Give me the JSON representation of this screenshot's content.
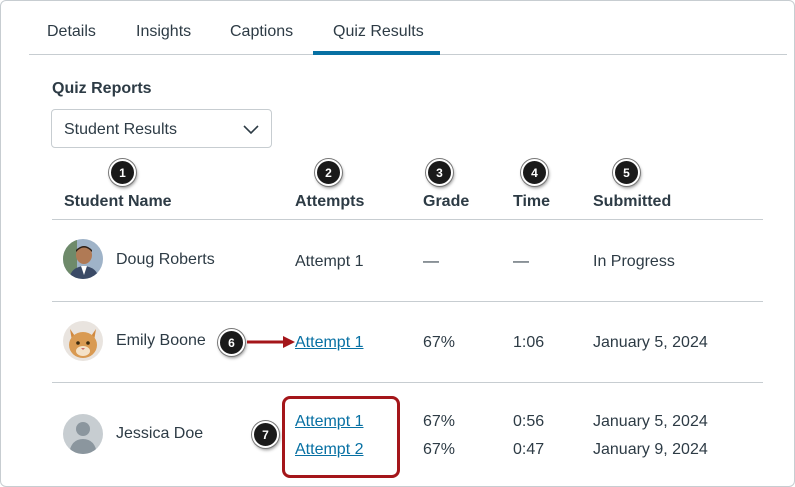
{
  "tabs": [
    {
      "label": "Details"
    },
    {
      "label": "Insights"
    },
    {
      "label": "Captions"
    },
    {
      "label": "Quiz Results"
    }
  ],
  "quiz_reports": {
    "title": "Quiz Reports",
    "selected": "Student Results"
  },
  "columns": [
    "Student Name",
    "Attempts",
    "Grade",
    "Time",
    "Submitted"
  ],
  "callouts": [
    "1",
    "2",
    "3",
    "4",
    "5",
    "6",
    "7"
  ],
  "rows": [
    {
      "name": "Doug Roberts",
      "attempts": [
        {
          "label": "Attempt 1",
          "grade": "—",
          "time": "—",
          "submitted": "In Progress"
        }
      ]
    },
    {
      "name": "Emily Boone",
      "attempts": [
        {
          "label": "Attempt 1",
          "grade": "67%",
          "time": "1:06",
          "submitted": "January 5, 2024"
        }
      ]
    },
    {
      "name": "Jessica Doe",
      "attempts": [
        {
          "label": "Attempt 1",
          "grade": "67%",
          "time": "0:56",
          "submitted": "January 5, 2024"
        },
        {
          "label": "Attempt 2",
          "grade": "67%",
          "time": "0:47",
          "submitted": "January 9, 2024"
        }
      ]
    }
  ],
  "colors": {
    "link": "#0770a3",
    "tab_underline": "#0770a3",
    "callout_arrow": "#a4161a"
  }
}
